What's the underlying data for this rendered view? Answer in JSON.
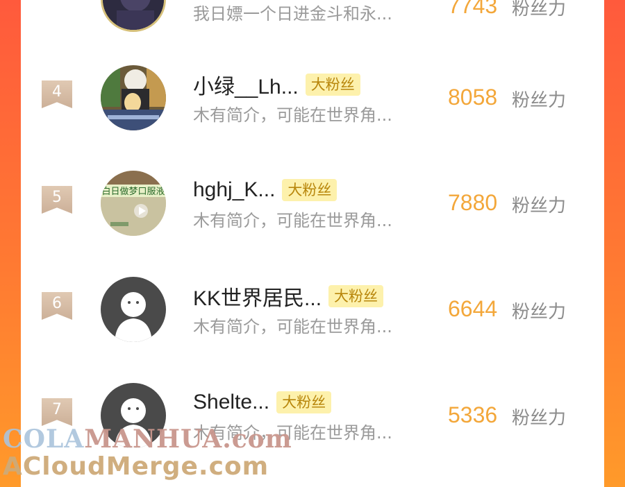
{
  "top_row": {
    "description": "我日嫖一个日进金斗和永...",
    "score": "7743",
    "unit": "粉丝力"
  },
  "rows": [
    {
      "rank": "4",
      "name": "小绿__Lh...",
      "badge": "大粉丝",
      "description": "木有简介，可能在世界角...",
      "score": "8058",
      "unit": "粉丝力",
      "avatar": "anime-avatar"
    },
    {
      "rank": "5",
      "name": "hghj_K...",
      "badge": "大粉丝",
      "description": "木有简介，可能在世界角...",
      "score": "7880",
      "unit": "粉丝力",
      "avatar": "video-thumbnail-avatar",
      "avatar_text": "白日做梦口服液"
    },
    {
      "rank": "6",
      "name": "KK世界居民...",
      "badge": "大粉丝",
      "description": "木有简介，可能在世界角...",
      "score": "6644",
      "unit": "粉丝力",
      "avatar": "default-avatar"
    },
    {
      "rank": "7",
      "name": "Shelte...",
      "badge": "大粉丝",
      "description": "木有简介，可能在世界角...",
      "score": "5336",
      "unit": "粉丝力",
      "avatar": "default-avatar"
    }
  ],
  "watermark": {
    "line1_a": "COLA",
    "line1_b": "MANHUA",
    "line1_c": ".com",
    "line2": "ACloudMerge.com"
  },
  "colors": {
    "background_top": "#ff5a3c",
    "background_bottom": "#ff9a2a",
    "score": "#f3a73a",
    "badge_bg": "#fdf1ac",
    "badge_text": "#b8860b",
    "rank_bg": "#d8bea6"
  }
}
